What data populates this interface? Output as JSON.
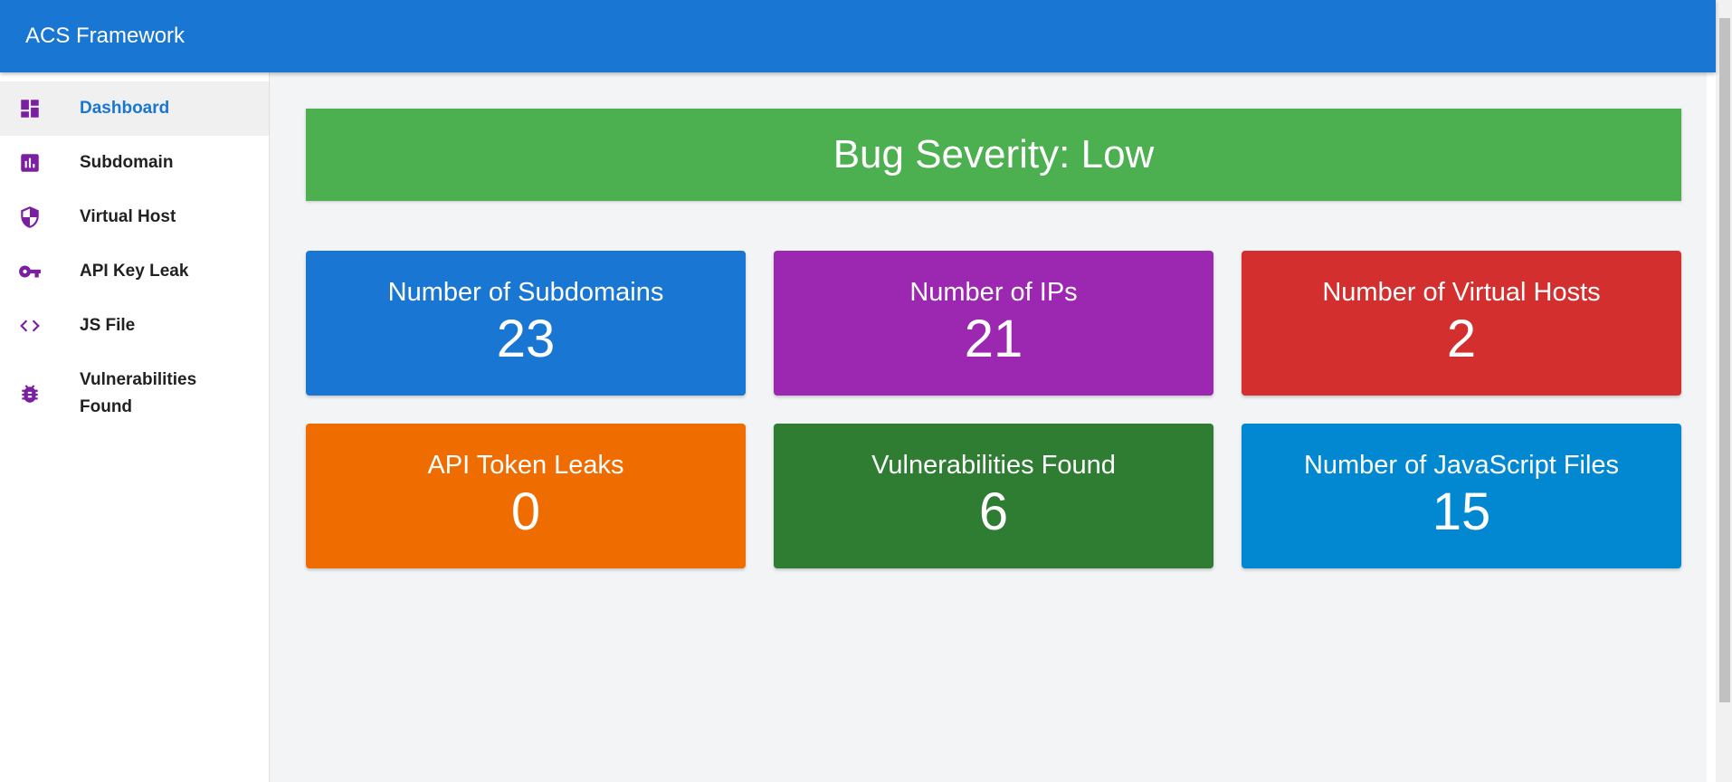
{
  "app": {
    "title": "ACS Framework"
  },
  "sidebar": {
    "items": [
      {
        "label": "Dashboard",
        "icon": "dashboard-icon",
        "active": true
      },
      {
        "label": "Subdomain",
        "icon": "bar-chart-icon"
      },
      {
        "label": "Virtual Host",
        "icon": "shield-icon"
      },
      {
        "label": "API Key Leak",
        "icon": "key-icon"
      },
      {
        "label": "JS File",
        "icon": "code-icon"
      },
      {
        "label": "Vulnerabilities Found",
        "icon": "bug-icon"
      }
    ],
    "icon_color": "#7b1fa2",
    "active_color": "#1976d2"
  },
  "severity": {
    "text": "Bug Severity: Low",
    "color": "#4caf50"
  },
  "cards": [
    {
      "title": "Number of Subdomains",
      "value": "23",
      "color": "#1976d2"
    },
    {
      "title": "Number of IPs",
      "value": "21",
      "color": "#9c27b0"
    },
    {
      "title": "Number of Virtual Hosts",
      "value": "2",
      "color": "#d32f2f"
    },
    {
      "title": "API Token Leaks",
      "value": "0",
      "color": "#ef6c00"
    },
    {
      "title": "Vulnerabilities Found",
      "value": "6",
      "color": "#2e7d32"
    },
    {
      "title": "Number of JavaScript Files",
      "value": "15",
      "color": "#0288d1"
    }
  ]
}
